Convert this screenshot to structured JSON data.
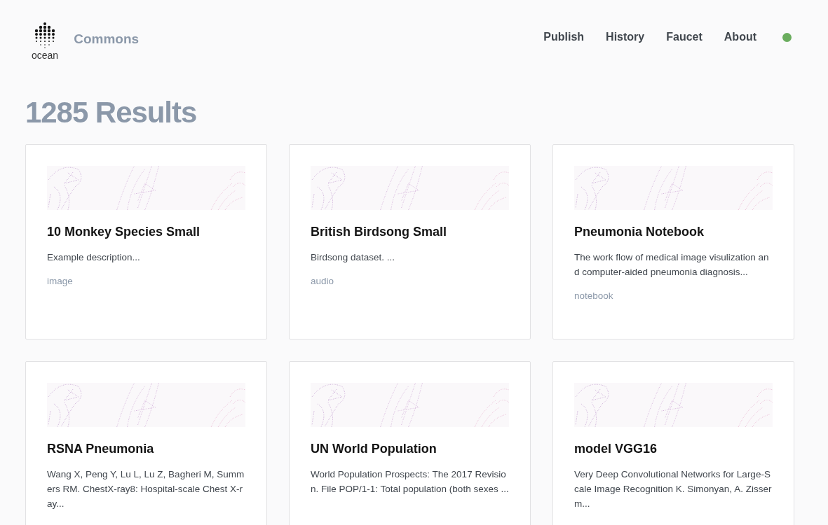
{
  "header": {
    "logo_text": "ocean",
    "app_name": "Commons",
    "nav": [
      "Publish",
      "History",
      "Faucet",
      "About"
    ],
    "status_dot": {
      "on": true
    }
  },
  "results_title": "1285 Results",
  "cards": [
    {
      "title": "10 Monkey Species Small",
      "description": "Example description...",
      "tag": "image"
    },
    {
      "title": "British Birdsong Small",
      "description": "Birdsong dataset. ...",
      "tag": "audio"
    },
    {
      "title": "Pneumonia Notebook",
      "description": "The work flow of medical image visulization and computer-aided pneumonia diagnosis...",
      "tag": "notebook"
    },
    {
      "title": "RSNA Pneumonia",
      "description": "Wang X, Peng Y, Lu L, Lu Z, Bagheri M, Summers RM. ChestX-ray8: Hospital-scale Chest X-ray..."
    },
    {
      "title": "UN World Population",
      "description": "World Population Prospects: The 2017 Revision. File POP/1-1: Total population (both sexes ..."
    },
    {
      "title": "model VGG16",
      "description": "Very Deep Convolutional Networks for Large-Scale Image Recognition K. Simonyan, A. Zisserm..."
    }
  ]
}
